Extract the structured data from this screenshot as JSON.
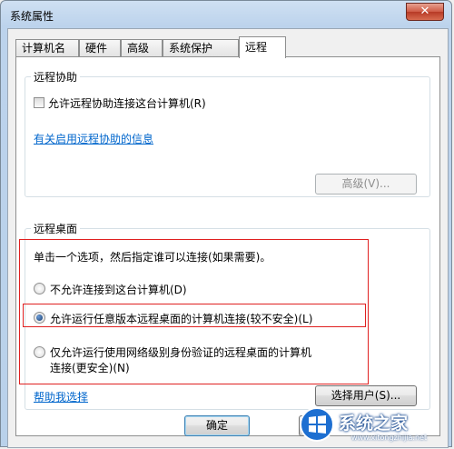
{
  "window": {
    "title": "系统属性",
    "close_glyph": "✕"
  },
  "tabs": [
    {
      "label": "计算机名"
    },
    {
      "label": "硬件"
    },
    {
      "label": "高级"
    },
    {
      "label": "系统保护"
    },
    {
      "label": "远程",
      "active": true
    }
  ],
  "remote_assistance": {
    "group_title": "远程协助",
    "checkbox_label": "允许远程协助连接这台计算机(R)",
    "checkbox_checked": false,
    "info_link": "有关启用远程协助的信息",
    "advanced_button": "高级(V)..."
  },
  "remote_desktop": {
    "group_title": "远程桌面",
    "instruction": "单击一个选项，然后指定谁可以连接(如果需要)。",
    "options": [
      {
        "label": "不允许连接到这台计算机(D)",
        "checked": false
      },
      {
        "label": "允许运行任意版本远程桌面的计算机连接(较不安全)(L)",
        "checked": true
      },
      {
        "label_line1": "仅允许运行使用网络级别身份验证的远程桌面的计算机",
        "label_line2": "连接(更安全)(N)",
        "checked": false
      }
    ],
    "help_link": "帮助我选择",
    "select_users_button": "选择用户(S)..."
  },
  "footer": {
    "ok_button": "确定"
  },
  "watermark": {
    "text": "系统之家",
    "url": "www.xitongzhijia.net"
  },
  "colors": {
    "accent": "#0066cc",
    "highlight_border": "#e02020"
  }
}
